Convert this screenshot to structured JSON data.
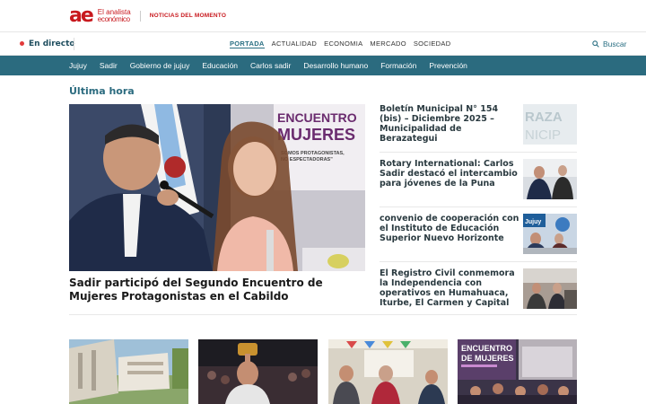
{
  "header": {
    "logo_line1": "El analista",
    "logo_line2": "económico",
    "tagline": "NOTICIAS DEL MOMENTO"
  },
  "nav": {
    "live_label": "En directo",
    "items": [
      "PORTADA",
      "ACTUALIDAD",
      "ECONOMIA",
      "MERCADO",
      "SOCIEDAD"
    ],
    "search_label": "Buscar"
  },
  "categories": [
    "Jujuy",
    "Sadir",
    "Gobierno de jujuy",
    "Educación",
    "Carlos sadir",
    "Desarrollo humano",
    "Formación",
    "Prevención"
  ],
  "section": {
    "title": "Última hora"
  },
  "hero": {
    "title": "Sadir participó del Segundo Encuentro de Mujeres Protagonistas en el Cabildo",
    "banner_text_1": "ENCUENTRO",
    "banner_text_2": "MUJERES",
    "banner_text_3": "SOMOS PROTAGONISTAS,",
    "banner_text_4": "NO ESPECTADORAS\""
  },
  "side_news": [
    {
      "title": "Boletín Municipal N° 154 (bis) – Diciembre 2025 – Municipalidad de Berazategui",
      "thumb_text_1": "RAZA",
      "thumb_text_2": "NICIP"
    },
    {
      "title": "Rotary International: Carlos Sadir destacó el intercambio para jóvenes de la Puna"
    },
    {
      "title": "convenio de cooperación con el Instituto de Educación Superior Nuevo Horizonte",
      "thumb_text_1": "Jujuy"
    },
    {
      "title": "El Registro Civil conmemora la Independencia con operativos en Humahuaca, Iturbe, El Carmen y Capital"
    }
  ],
  "cards": [
    {
      "title": ""
    },
    {
      "title": ""
    },
    {
      "title": ""
    },
    {
      "title": "",
      "thumb_text_1": "ENCUENTRO",
      "thumb_text_2": "DE MUJERES"
    }
  ]
}
